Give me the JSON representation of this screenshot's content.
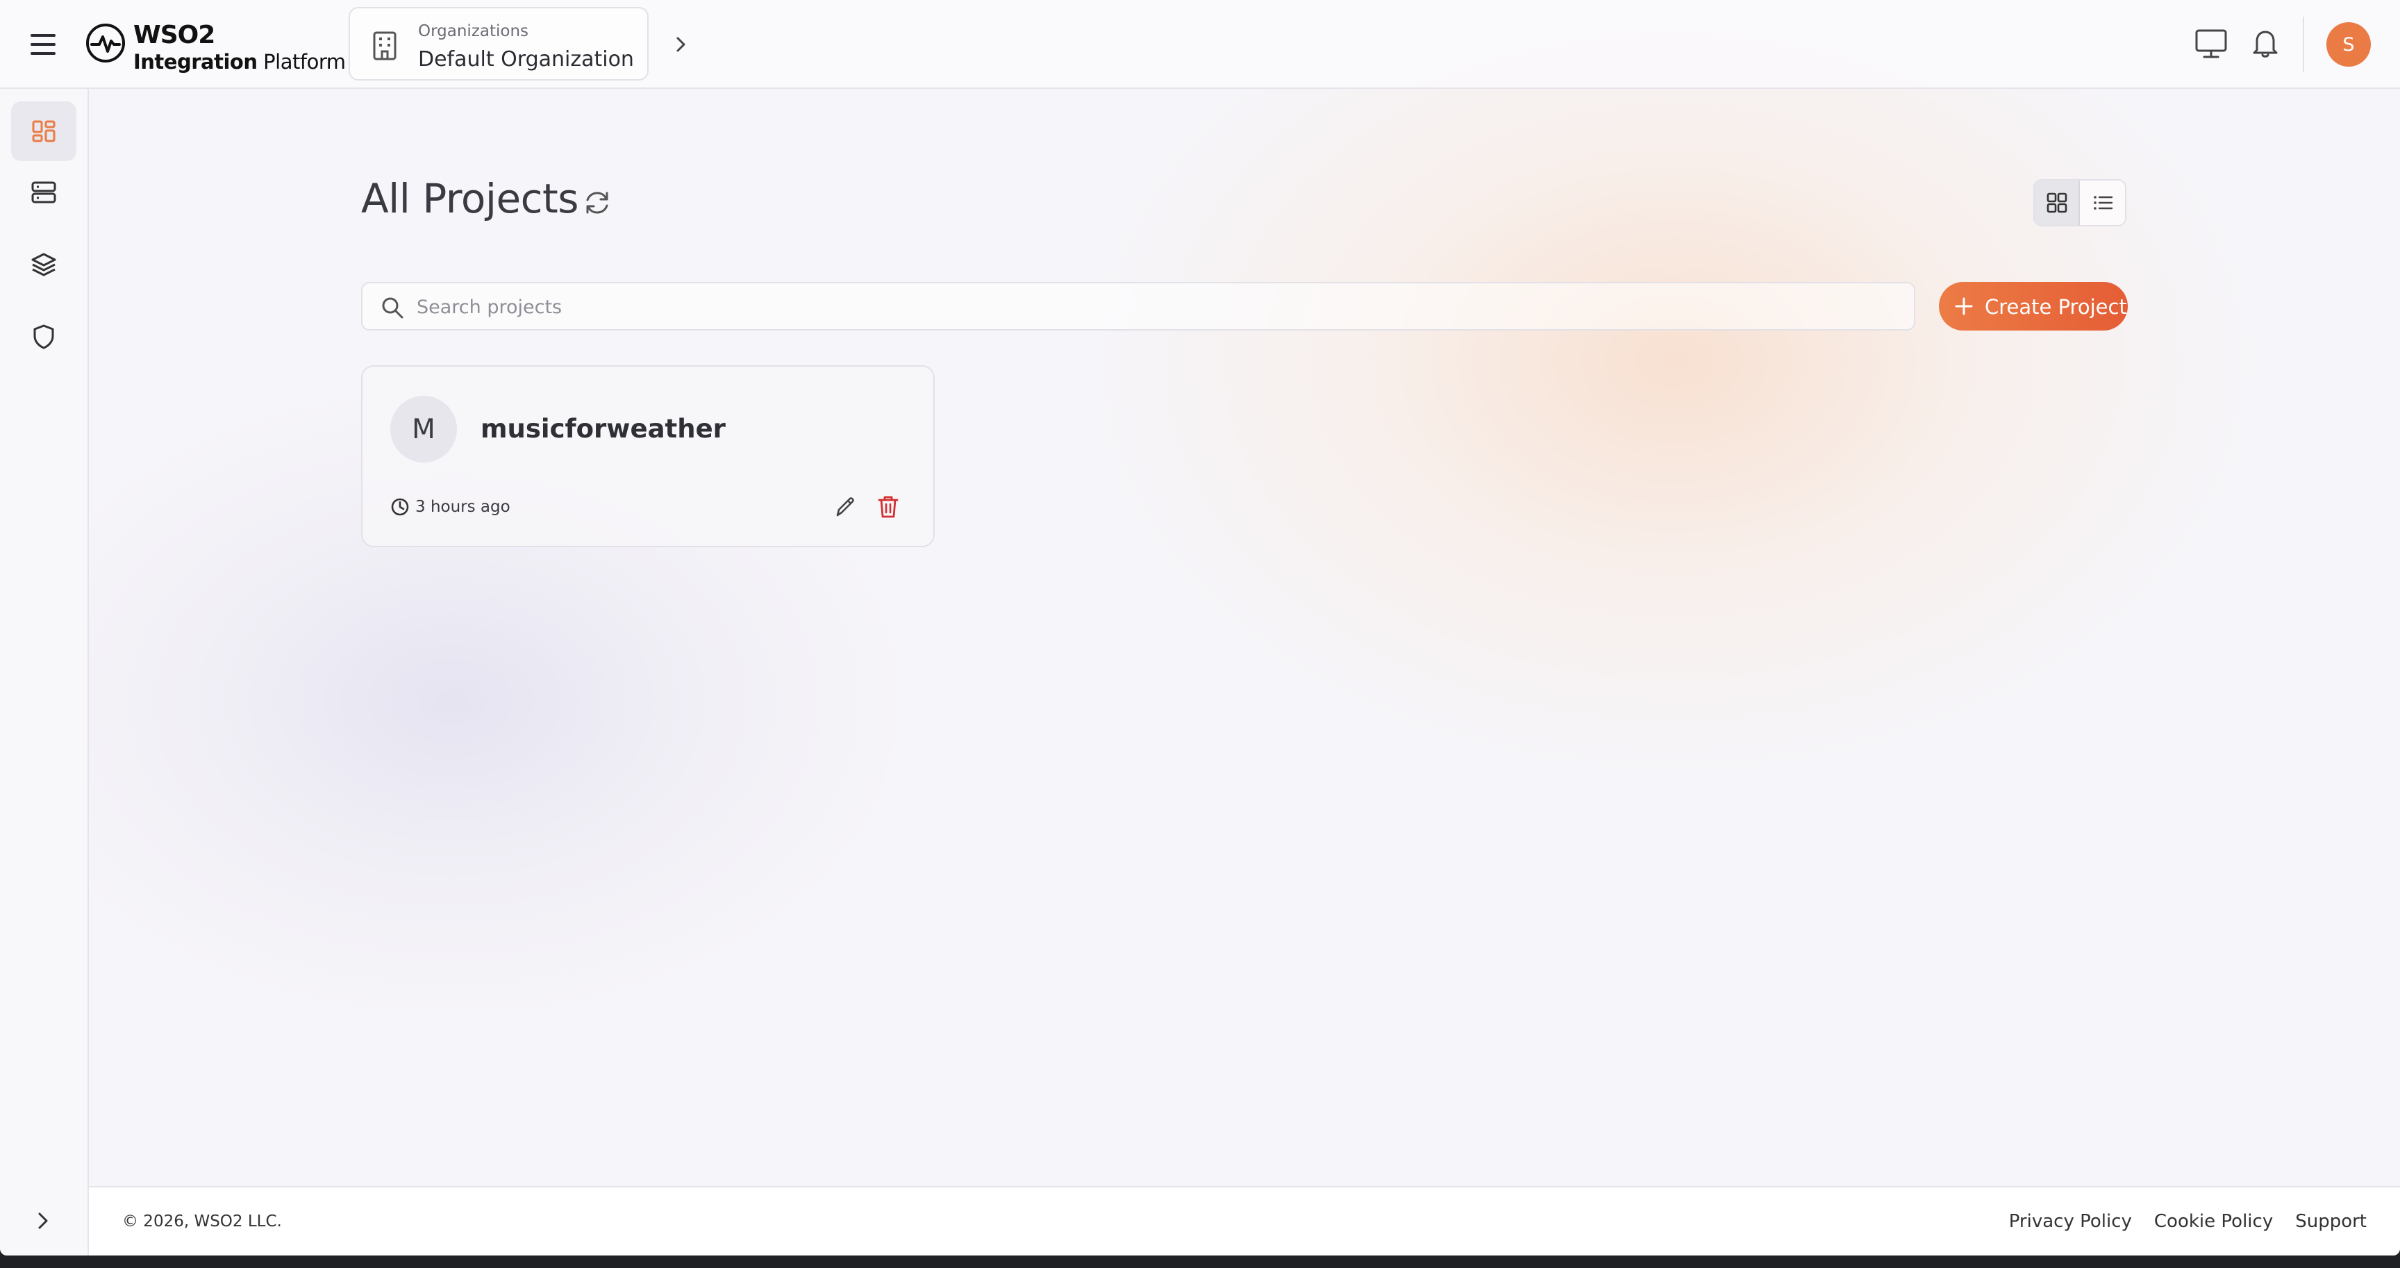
{
  "header": {
    "logo_title": "WSO2",
    "logo_subtitle_bold": "Integration",
    "logo_subtitle_rest": " Platform",
    "org_label": "Organizations",
    "org_value": "Default Organization",
    "avatar_initial": "S"
  },
  "main": {
    "title": "All Projects",
    "search_placeholder": "Search projects",
    "search_value": "",
    "create_button_label": "Create Project",
    "view_mode": "grid"
  },
  "projects": [
    {
      "initial": "M",
      "name": "musicforweather",
      "updated": "3 hours ago"
    }
  ],
  "sidebar": {
    "items": [
      {
        "icon": "dashboard-icon",
        "active": true
      },
      {
        "icon": "server-icon",
        "active": false
      },
      {
        "icon": "layers-icon",
        "active": false
      },
      {
        "icon": "shield-icon",
        "active": false
      }
    ]
  },
  "footer": {
    "copyright": "© 2026, WSO2 LLC.",
    "links": [
      "Privacy Policy",
      "Cookie Policy",
      "Support"
    ]
  },
  "colors": {
    "accent": "#ea7b45",
    "accent_dark": "#e55d35",
    "danger": "#d32f2f",
    "background": "#f6f5f9"
  }
}
